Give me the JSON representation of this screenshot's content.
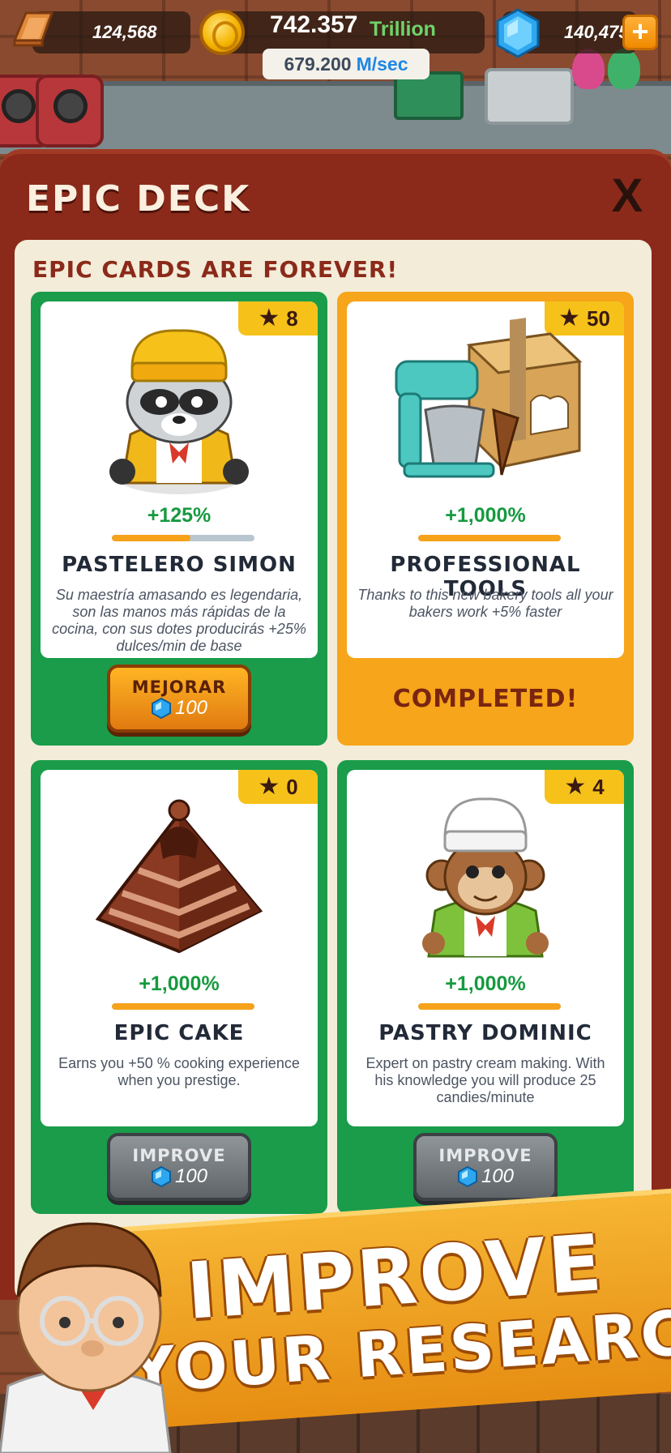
{
  "resources": {
    "gold_bars": "124,568",
    "coins": "742.357",
    "coins_unit": "Trillion",
    "rate_value": "679.200",
    "rate_unit": "M/sec",
    "gems": "140,475",
    "add_label": "+"
  },
  "panel": {
    "title": "EPIC DECK",
    "close_label": "X",
    "subtitle": "EPIC CARDS ARE FOREVER!"
  },
  "cards": [
    {
      "stars": "8",
      "percent": "+125%",
      "progress": 0.55,
      "name": "PASTELERO SIMON",
      "description": "Su maestría amasando es legendaria, son las manos más rápidas de la cocina, con sus dotes producirás +25% dulces/min de base",
      "button_label": "MEJORAR",
      "button_cost": "100",
      "frame": "green",
      "art": "raccoon-chef-icon"
    },
    {
      "stars": "50",
      "percent": "+1,000%",
      "progress": 1.0,
      "name": "PROFESSIONAL TOOLS",
      "description": "Thanks to this new bakery tools all your bakers work +5% faster",
      "status_label": "COMPLETED!",
      "frame": "orange",
      "art": "bakery-tools-icon"
    },
    {
      "stars": "0",
      "percent": "+1,000%",
      "progress": 1.0,
      "name": "EPIC CAKE",
      "description": "Earns you +50 % cooking experience when you prestige.",
      "button_label": "IMPROVE",
      "button_cost": "100",
      "frame": "green",
      "art": "pyramid-cake-icon"
    },
    {
      "stars": "4",
      "percent": "+1,000%",
      "progress": 1.0,
      "name": "PASTRY DOMINIC",
      "description": "Expert on pastry cream making. With his knowledge you will produce 25 candies/minute",
      "button_label": "IMPROVE",
      "button_cost": "100",
      "frame": "green",
      "art": "monkey-chef-icon"
    }
  ],
  "promo": {
    "line1": "IMPROVE",
    "line2": "YOUR RESEARCH!"
  },
  "colors": {
    "panel": "#8b2a1a",
    "card_green": "#1a9c4a",
    "card_orange": "#f7a51a",
    "percent": "#169a3f",
    "progress_fill": "#f6a21a"
  }
}
